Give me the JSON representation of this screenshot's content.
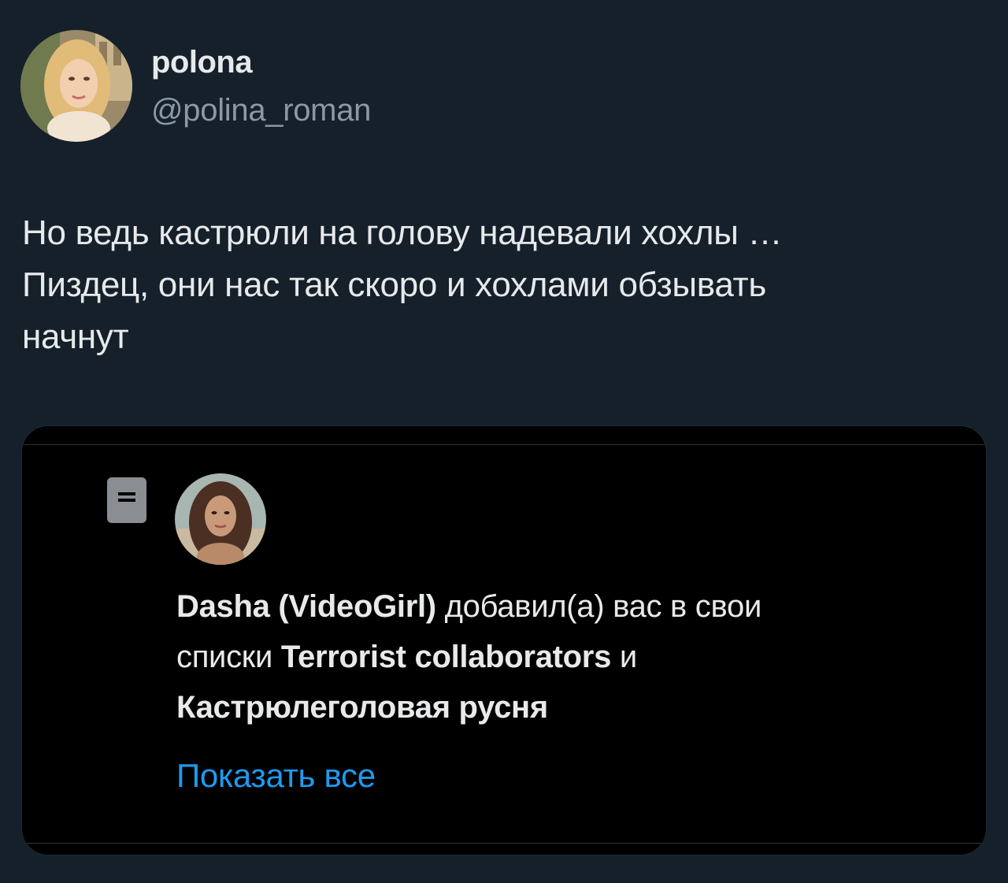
{
  "tweet": {
    "author": {
      "display_name": "polona",
      "handle": "@polina_roman",
      "avatar_icon": "profile-photo-avatar"
    },
    "text_lines": [
      "Но ведь кастрюли на голову надевали хохлы …",
      "Пиздец, они нас так скоро и хохлами обзывать",
      "начнут"
    ]
  },
  "notification": {
    "type_icon": "list-icon",
    "avatar_icon": "profile-photo-avatar",
    "actor_name": "Dasha (VideoGirl)",
    "action_text": " добавил(а) вас в свои",
    "lists_prefix": "списки ",
    "list_one": "Terrorist collaborators",
    "conjunction": " и",
    "list_two": "Кастрюлеголовая русня",
    "show_all_label": "Показать все"
  },
  "colors": {
    "background": "#15202b",
    "card_background": "#000000",
    "primary_text": "#e7e9ea",
    "secondary_text": "#8b98a5",
    "link": "#1d9bf0"
  }
}
